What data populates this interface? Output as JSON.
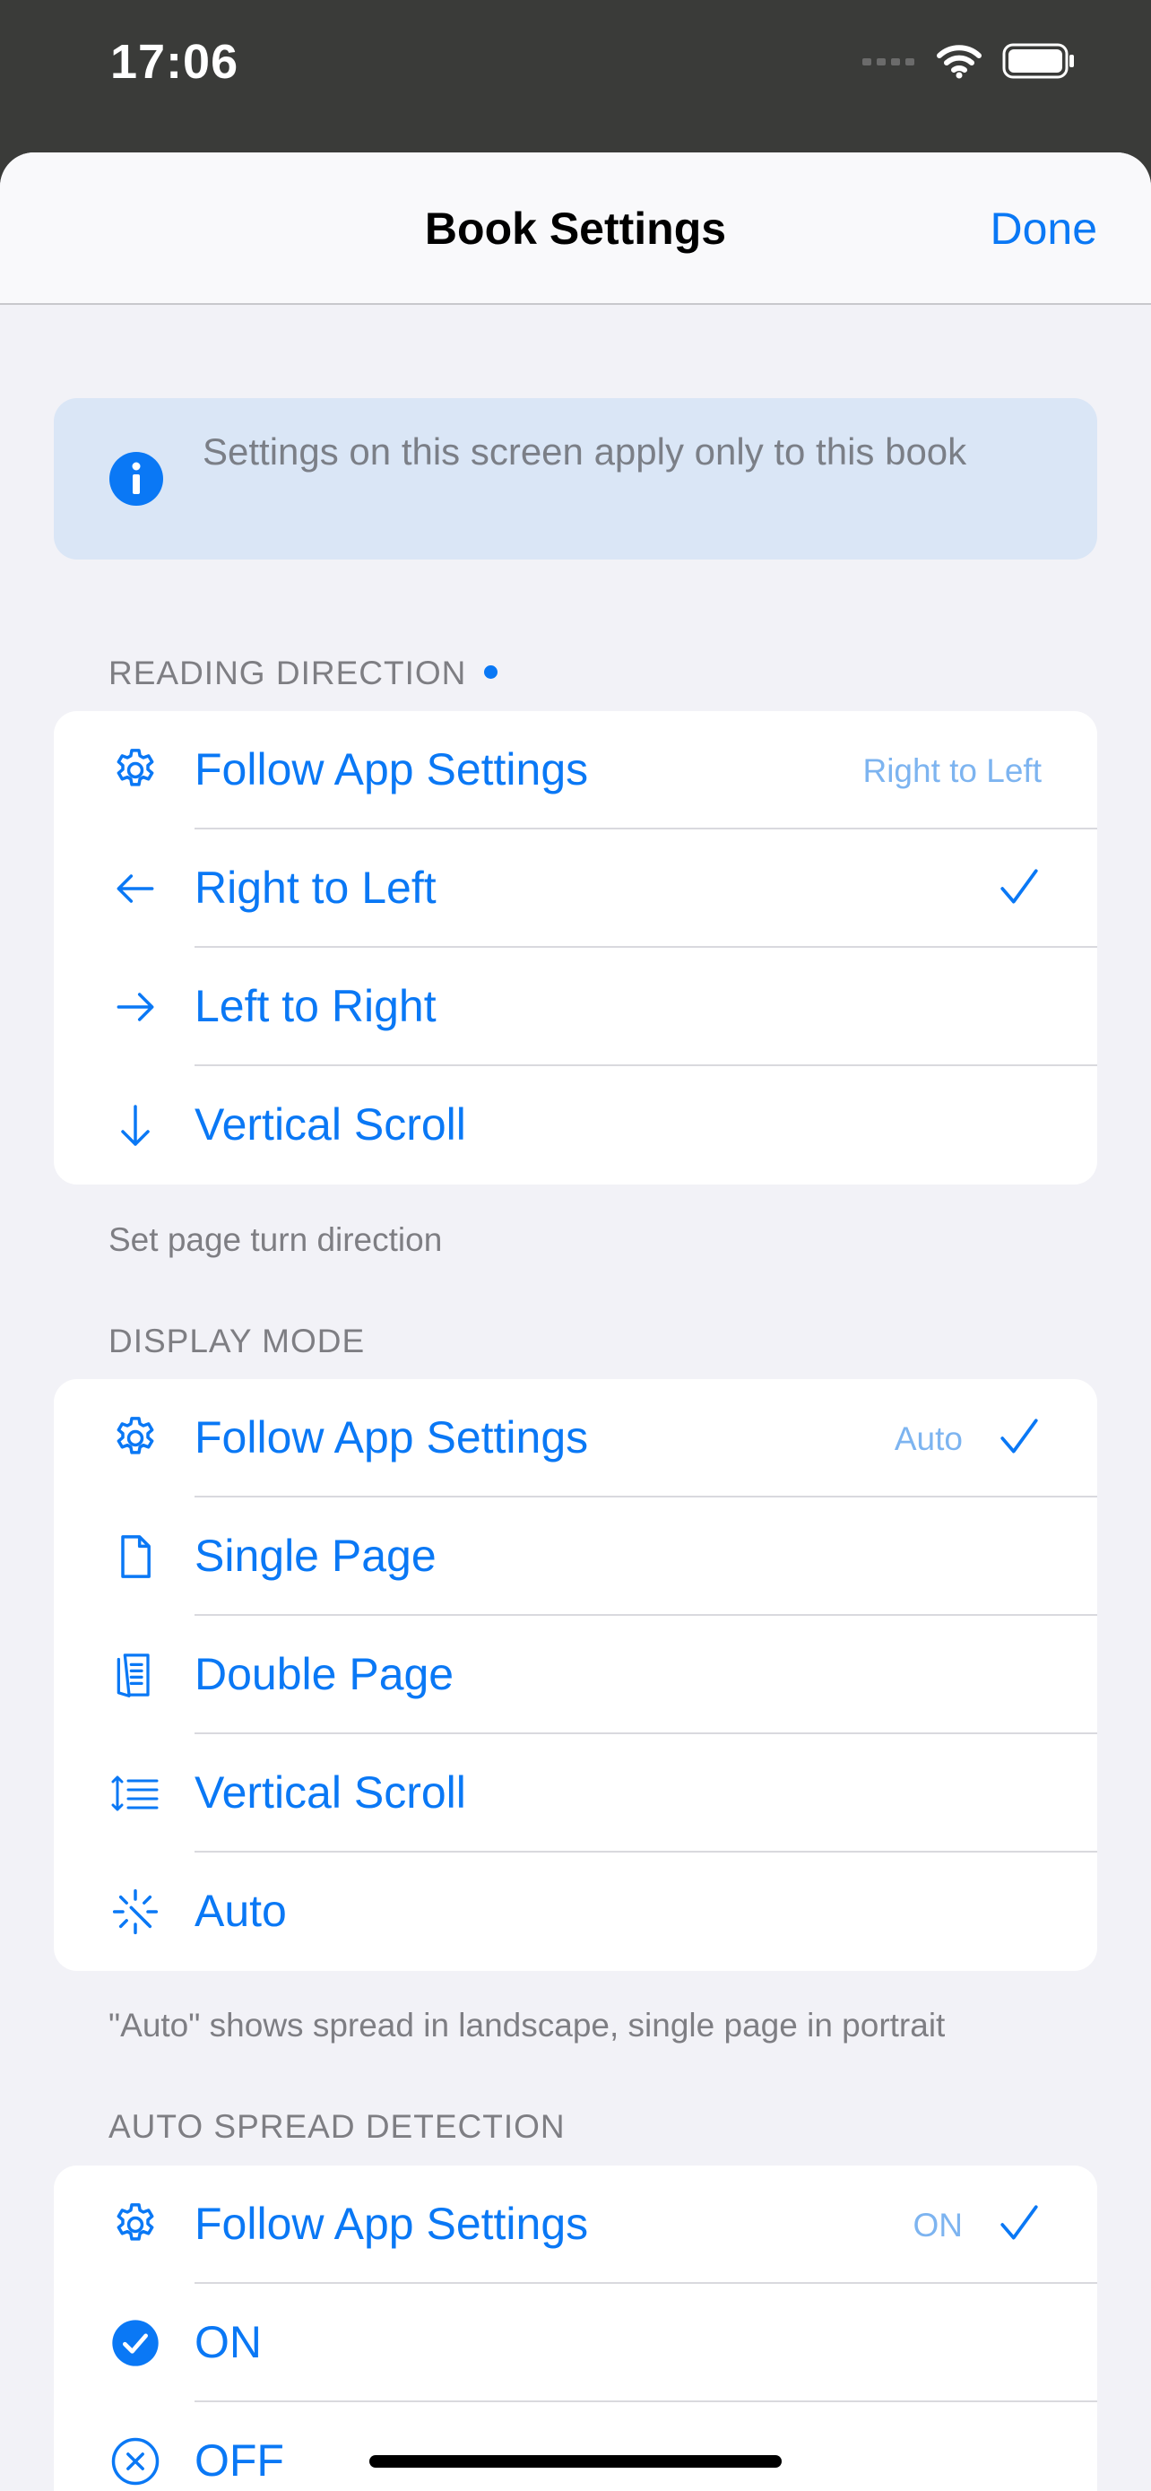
{
  "status_bar": {
    "time": "17:06"
  },
  "nav": {
    "title": "Book Settings",
    "done_label": "Done"
  },
  "info_banner": {
    "text": "Settings on this screen apply only to this book"
  },
  "reading_direction": {
    "header": "READING DIRECTION",
    "footer": "Set page turn direction",
    "items": [
      {
        "label": "Follow App Settings",
        "value": "Right to Left",
        "icon": "gear-icon",
        "checked": false
      },
      {
        "label": "Right to Left",
        "icon": "arrow-left-icon",
        "checked": true
      },
      {
        "label": "Left to Right",
        "icon": "arrow-right-icon",
        "checked": false
      },
      {
        "label": "Vertical Scroll",
        "icon": "arrow-down-icon",
        "checked": false
      }
    ]
  },
  "display_mode": {
    "header": "DISPLAY MODE",
    "footer": "\"Auto\" shows spread in landscape, single page in portrait",
    "items": [
      {
        "label": "Follow App Settings",
        "value": "Auto",
        "icon": "gear-icon",
        "checked": true
      },
      {
        "label": "Single Page",
        "icon": "document-icon",
        "checked": false
      },
      {
        "label": "Double Page",
        "icon": "double-page-icon",
        "checked": false
      },
      {
        "label": "Vertical Scroll",
        "icon": "vertical-scroll-list-icon",
        "checked": false
      },
      {
        "label": "Auto",
        "icon": "auto-sparkle-icon",
        "checked": false
      }
    ]
  },
  "auto_spread": {
    "header": "AUTO SPREAD DETECTION",
    "items": [
      {
        "label": "Follow App Settings",
        "value": "ON",
        "icon": "gear-icon",
        "checked": true
      },
      {
        "label": "ON",
        "icon": "checkmark-circle-fill-icon",
        "checked": false
      },
      {
        "label": "OFF",
        "icon": "xmark-circle-icon",
        "checked": false
      }
    ]
  },
  "colors": {
    "accent": "#0a78f5",
    "background": "#f2f2f7",
    "info_bg": "#dae6f6",
    "value_text": "#7db4f0"
  }
}
